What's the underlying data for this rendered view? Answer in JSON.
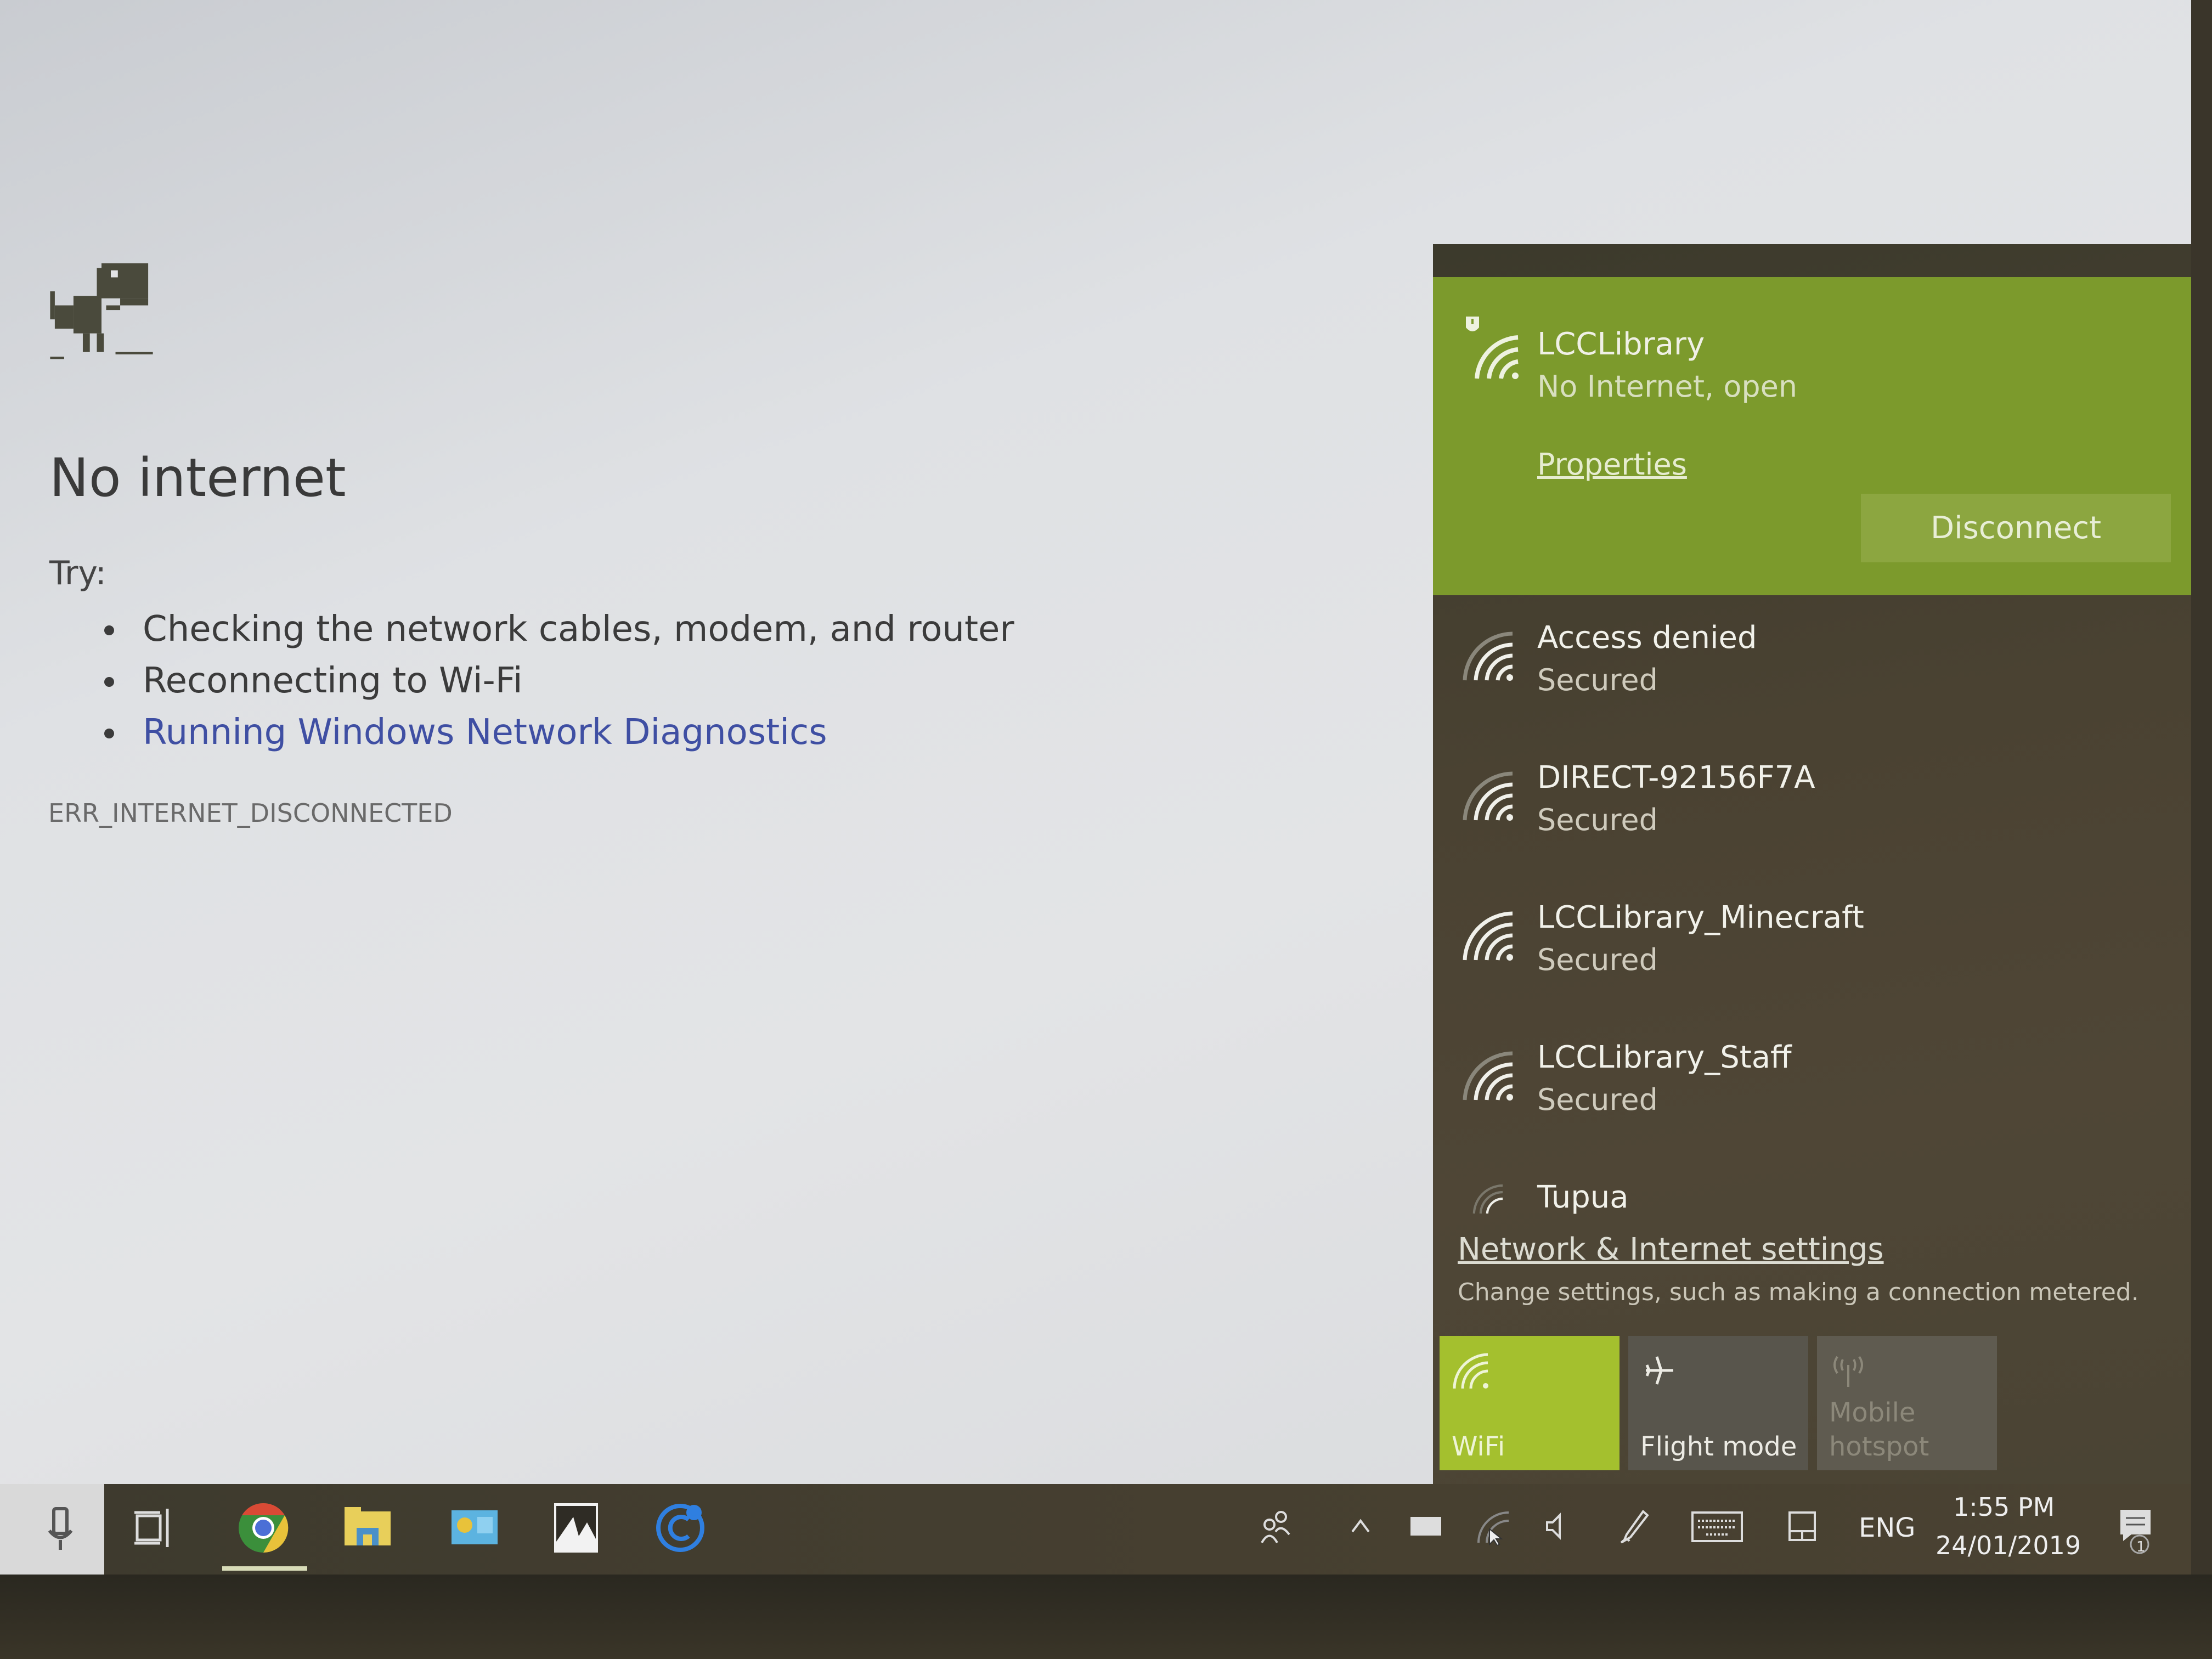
{
  "error_page": {
    "title": "No internet",
    "try_label": "Try:",
    "suggestions": [
      {
        "text": "Checking the network cables, modem, and router",
        "is_link": false
      },
      {
        "text": "Reconnecting to Wi-Fi",
        "is_link": false
      },
      {
        "text": "Running Windows Network Diagnostics",
        "is_link": true
      }
    ],
    "error_code": "ERR_INTERNET_DISCONNECTED",
    "dino_icon": "offline-dinosaur-icon"
  },
  "network_flyout": {
    "connected": {
      "name": "LCCLibrary",
      "status": "No Internet, open",
      "properties_label": "Properties",
      "disconnect_label": "Disconnect",
      "icon": "wifi-warning-icon",
      "accent_color": "#7c9a2c"
    },
    "networks": [
      {
        "name": "Access denied",
        "status": "Secured",
        "icon": "wifi-signal-icon"
      },
      {
        "name": "DIRECT-92156F7A",
        "status": "Secured",
        "icon": "wifi-signal-icon"
      },
      {
        "name": "LCCLibrary_Minecraft",
        "status": "Secured",
        "icon": "wifi-signal-icon"
      },
      {
        "name": "LCCLibrary_Staff",
        "status": "Secured",
        "icon": "wifi-signal-icon"
      },
      {
        "name": "Tupua",
        "status": "",
        "icon": "wifi-signal-weak-icon"
      }
    ],
    "settings_link": "Network & Internet settings",
    "settings_description": "Change settings, such as making a connection metered.",
    "quick_actions": [
      {
        "label": "WiFi",
        "icon": "wifi-icon",
        "state": "on"
      },
      {
        "label": "Flight mode",
        "icon": "airplane-icon",
        "state": "off"
      },
      {
        "label": "Mobile hotspot",
        "icon": "hotspot-icon",
        "state": "disabled"
      }
    ]
  },
  "taskbar": {
    "pinned": [
      "microphone-icon",
      "task-view-icon",
      "chrome-icon",
      "file-explorer-icon",
      "control-panel-icon",
      "photos-icon",
      "app-icon"
    ],
    "language": "ENG",
    "time": "1:55 PM",
    "date": "24/01/2019",
    "notification_count": "1"
  }
}
